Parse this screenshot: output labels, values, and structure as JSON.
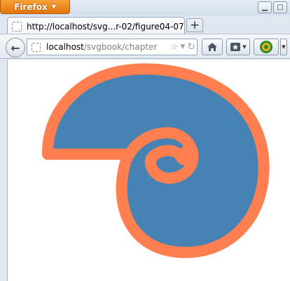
{
  "browser": {
    "app_button_label": "Firefox",
    "tab": {
      "title": "http://localhost/svg...r-02/figure04-07.svg"
    },
    "new_tab_label": "+",
    "url": {
      "host": "localhost",
      "path": "/svgbook/chapter"
    }
  },
  "icons": {
    "app_menu": "chevron-down",
    "minimize": "minimize",
    "maximize": "maximize",
    "back": "arrow-left",
    "bookmark": "star",
    "reload": "reload",
    "home": "home",
    "bookmarks_menu": "bookmarks",
    "addon": "addon"
  },
  "figure": {
    "fill_color": "#4682b4",
    "stroke_color": "#ff7f50"
  }
}
